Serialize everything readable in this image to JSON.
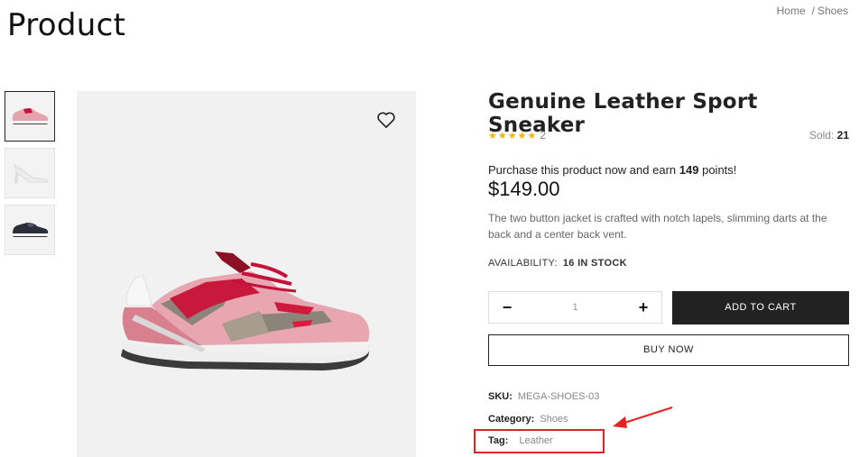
{
  "header": {
    "title": "Product",
    "breadcrumb": {
      "home": "Home",
      "separator": "/",
      "current": "Shoes"
    }
  },
  "gallery": {
    "thumbnails": [
      {
        "name": "pink-sneaker",
        "active": true
      },
      {
        "name": "white-heel",
        "active": false
      },
      {
        "name": "black-sneaker",
        "active": false
      }
    ],
    "wishlist_icon": "heart-outline-icon"
  },
  "product": {
    "name": "Genuine Leather Sport Sneaker",
    "rating": {
      "stars": "★★★★★",
      "value": 5,
      "count": "2"
    },
    "sold_label": "Sold:",
    "sold_value": "21",
    "points_prefix": "Purchase this product now and earn",
    "points_value": "149",
    "points_suffix": "points!",
    "price": "$149.00",
    "description": "The two button jacket is crafted with notch lapels, slimming darts at the back and a center back vent.",
    "availability_label": "AVAILABILITY:",
    "availability_value": "16 IN STOCK",
    "quantity": {
      "minus": "−",
      "value": "1",
      "plus": "+"
    },
    "add_to_cart": "ADD TO CART",
    "buy_now": "BUY NOW",
    "sku_label": "SKU:",
    "sku_value": "MEGA-SHOES-03",
    "category_label": "Category:",
    "category_value": "Shoes",
    "tag_label": "Tag:",
    "tag_value": "Leather"
  },
  "colors": {
    "accent_dark": "#222222",
    "annotation_red": "#e52222",
    "star": "#f5b301"
  }
}
